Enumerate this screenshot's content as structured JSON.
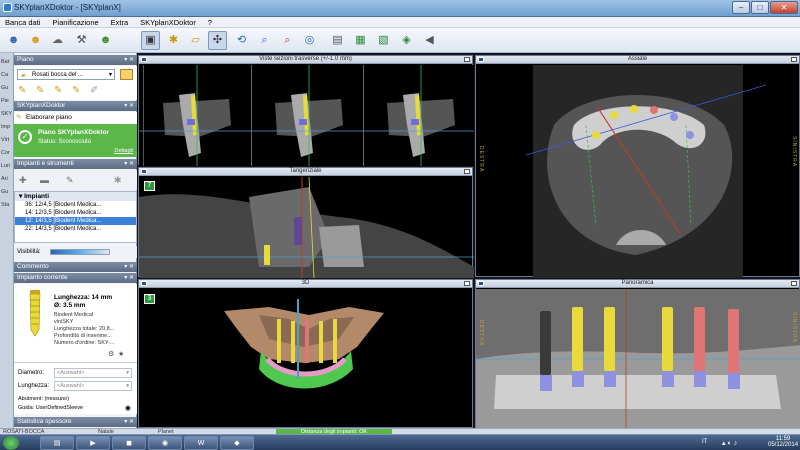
{
  "window": {
    "title": "SKYplanXDoktor - [SKYplanX]"
  },
  "menu": [
    "Banca dati",
    "Pianificazione",
    "Extra",
    "SKYplanXDoktor",
    "?"
  ],
  "toolbar": {
    "icons": [
      "patient-icon",
      "patient-open-icon",
      "cloud-icon",
      "tools-icon",
      "patient-add-icon",
      "layout-icon",
      "implant-icon",
      "ruler-icon",
      "crosshair-icon",
      "rotate-icon",
      "zoom-icon",
      "zoom-region-icon",
      "zoom-fit-icon",
      "export-icon",
      "group-icon",
      "layers-icon",
      "measure-icon",
      "sound-icon"
    ]
  },
  "left": {
    "piano_header": "Piano",
    "plan_select": "Rosati bocca del ...",
    "doctor_header": "SKYplanXDoktor",
    "elaborate": "Elaborare piano",
    "plan_name": "Piano SKYplanXDoktor",
    "plan_status": "Status: Sconosciuto",
    "details_link": "Dettagli",
    "impianti_header": "Impianti e strumenti",
    "tree_root": "Impianti",
    "implants": [
      "36: 12/4,5 [Biodent Medica...",
      "14: 12/3,5 [Biodent Medica...",
      "12: 14/3,5 [Biodent Medica...",
      "22: 14/3,5 [Biodent Medica..."
    ],
    "visibility_label": "Visibilità:",
    "commento_header": "Commento",
    "impianto_header": "Impianto corrente",
    "length": "Lunghezza: 14 mm",
    "diameter": "Ø: 3.5 mm",
    "impl_info": [
      "Biodent Medical",
      "viniSKY",
      "Lunghezza totale: 20,8...",
      "Profondità di inserime...",
      "Numero d'ordine: SKY-..."
    ],
    "diametro_label": "Diametro:",
    "diametro_val": "<Auswahl>",
    "lunghezza_label": "Lunghezza:",
    "lunghezza_val": "<Auswahl>",
    "abutment": "Abutment: (nessuno)",
    "guide": "Guida: UserDefinedSleeve",
    "statistics": "Statistica spessore",
    "strip_labels": [
      "Bar",
      "Ca",
      "Gu",
      "Pie",
      "SKY",
      "Imp",
      "Virt",
      "Cor",
      "Lun",
      "Ari",
      "Gu",
      "Sta"
    ]
  },
  "views": {
    "cross_title": "Viste sezioni trasverse (+/-1.0 mm)",
    "tangential_title": "Tangenziale",
    "axial_title": "Assiale",
    "threed_title": "3D",
    "pano_title": "Panoramica",
    "view_badge_2d": "7",
    "view_badge_3d": "3",
    "side_letters": {
      "m": "MESIALE",
      "d": "DISTALE",
      "dx": "DESTRA",
      "sx": "SINISTRA"
    }
  },
  "status": {
    "left": "ROSATI-BOCCA",
    "mid1": "Natale",
    "mid2": "Planet",
    "center": "Distanza degli impianti: OK"
  },
  "taskbar": {
    "apps": [
      "start-icon",
      "explorer-icon",
      "mediaplayer-icon",
      "sky-icon",
      "chrome-icon",
      "word-icon",
      "sky-app-icon"
    ],
    "lang": "IT",
    "time": "11:59",
    "date": "05/12/2014"
  },
  "colors": {
    "accent": "#5ab748",
    "implant_yellow": "#e7da3a",
    "implant_red": "#e07575",
    "sleeve": "#8f90e0",
    "bone": "#b28a6a"
  }
}
